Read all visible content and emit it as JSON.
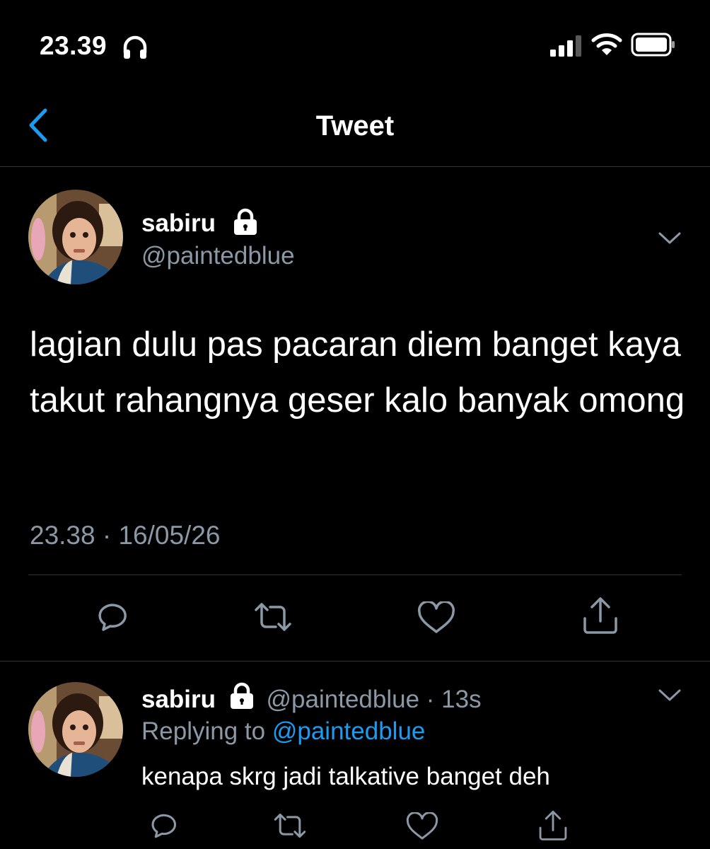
{
  "status_bar": {
    "time": "23.39",
    "icons": [
      "headphone-icon",
      "signal-icon",
      "wifi-icon",
      "battery-icon"
    ]
  },
  "nav": {
    "title": "Tweet",
    "back_icon": "chevron-left-icon",
    "accent_color": "#1d9bf0"
  },
  "main_tweet": {
    "display_name": "sabiru",
    "handle": "@paintedblue",
    "protected_icon": "lock-icon",
    "text": "lagian dulu pas pacaran diem banget kaya takut rahangnya geser kalo banyak omong",
    "timestamp": "23.38 · 16/05/26",
    "actions": [
      "reply-icon",
      "retweet-icon",
      "like-icon",
      "share-icon"
    ]
  },
  "reply_tweet": {
    "display_name": "sabiru",
    "handle": "@paintedblue",
    "age": "· 13s",
    "replying_prefix": "Replying to",
    "replying_handle": "@paintedblue",
    "text": "kenapa skrg jadi talkative banget deh",
    "actions": [
      "reply-icon",
      "retweet-icon",
      "like-icon",
      "share-icon"
    ]
  },
  "colors": {
    "background": "#000000",
    "text": "#ffffff",
    "secondary_text": "#8b98a5",
    "link": "#1d9bf0",
    "divider": "#2f3336"
  }
}
